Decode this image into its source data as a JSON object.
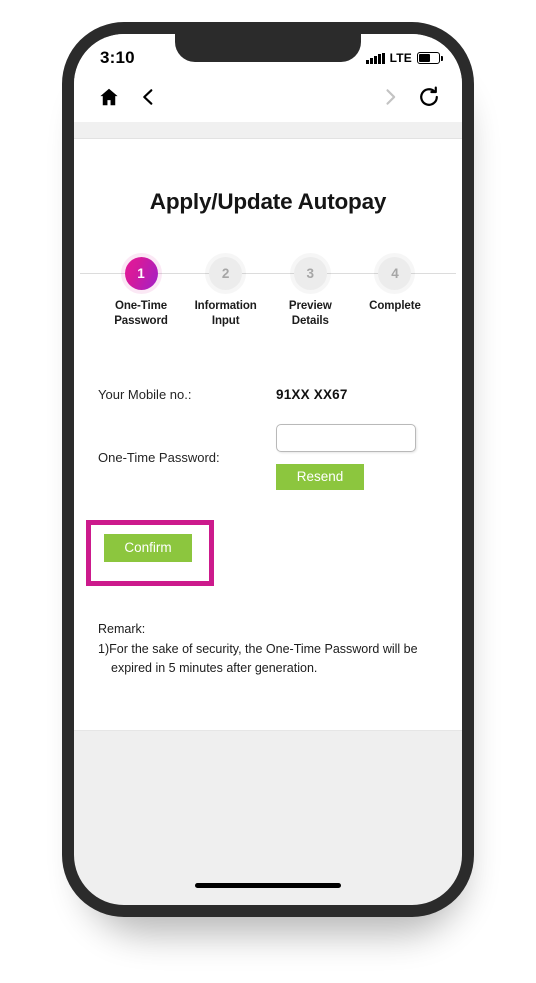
{
  "status_bar": {
    "time": "3:10",
    "network": "LTE",
    "signal_icon": "signal-bars-icon",
    "battery_icon": "battery-icon"
  },
  "browser_nav": {
    "home_icon": "home-icon",
    "back_icon": "chevron-left-icon",
    "forward_icon": "chevron-right-icon",
    "reload_icon": "reload-icon"
  },
  "page": {
    "title": "Apply/Update Autopay"
  },
  "stepper": {
    "steps": [
      {
        "number": "1",
        "label": "One-Time\nPassword",
        "label_line1": "One-Time",
        "label_line2": "Password",
        "state": "active"
      },
      {
        "number": "2",
        "label": "Information\nInput",
        "label_line1": "Information",
        "label_line2": "Input",
        "state": "inactive"
      },
      {
        "number": "3",
        "label": "Preview\nDetails",
        "label_line1": "Preview",
        "label_line2": "Details",
        "state": "inactive"
      },
      {
        "number": "4",
        "label": "Complete",
        "label_line1": "Complete",
        "label_line2": "",
        "state": "inactive"
      }
    ]
  },
  "form": {
    "mobile_label": "Your Mobile no.:",
    "mobile_value": "91XX XX67",
    "otp_label": "One-Time Password:",
    "otp_value": "",
    "otp_placeholder": "",
    "resend_label": "Resend",
    "confirm_label": "Confirm"
  },
  "remark": {
    "title": "Remark:",
    "item_number": "1)",
    "item_text": "For the sake of security, the One-Time Password will be expired in 5 minutes after generation."
  },
  "colors": {
    "accent_green": "#8cc63e",
    "highlight_magenta": "#cc1a8c",
    "step_active_from": "#e6189a",
    "step_active_to": "#a021c9",
    "step_inactive_bg": "#ececec"
  }
}
